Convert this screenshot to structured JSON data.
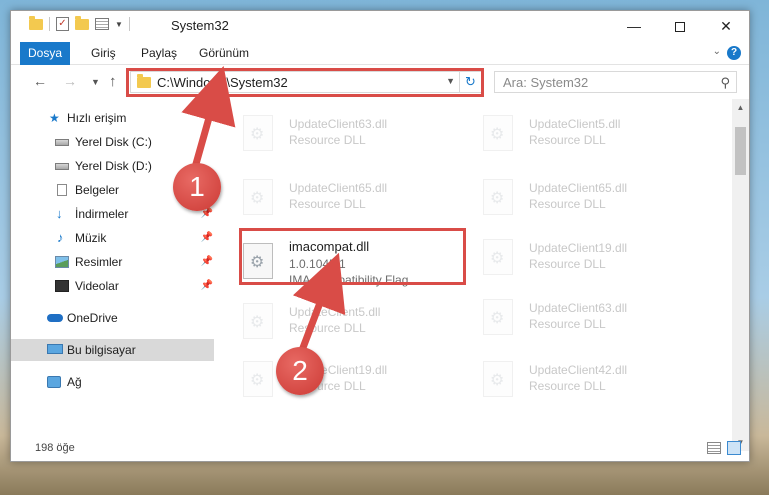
{
  "window": {
    "title": "System32",
    "minimize_glyph": "—",
    "close_glyph": "✕"
  },
  "ribbon": {
    "tabs": [
      "Dosya",
      "Giriş",
      "Paylaş",
      "Görünüm"
    ],
    "help_glyph": "?",
    "expand_glyph": "⌄"
  },
  "address": {
    "path": "C:\\Windows\\System32",
    "search_placeholder": "Ara: System32"
  },
  "nav": {
    "back_glyph": "←",
    "forward_glyph": "→",
    "up_glyph": "↑",
    "items": [
      {
        "label": "Hızlı erişim",
        "icon": "star-icon"
      },
      {
        "label": "Yerel Disk (C:)",
        "icon": "drive-icon",
        "pinned": true
      },
      {
        "label": "Yerel Disk (D:)",
        "icon": "drive-icon",
        "pinned": true
      },
      {
        "label": "Belgeler",
        "icon": "documents-icon",
        "pinned": true
      },
      {
        "label": "İndirmeler",
        "icon": "downloads-icon",
        "pinned": true
      },
      {
        "label": "Müzik",
        "icon": "music-icon",
        "pinned": true
      },
      {
        "label": "Resimler",
        "icon": "pictures-icon",
        "pinned": true
      },
      {
        "label": "Videolar",
        "icon": "videos-icon",
        "pinned": true
      },
      {
        "label": "OneDrive",
        "icon": "onedrive-icon"
      },
      {
        "label": "Bu bilgisayar",
        "icon": "pc-icon",
        "selected": true
      },
      {
        "label": "Ağ",
        "icon": "network-icon"
      }
    ]
  },
  "files": {
    "left": [
      {
        "name": "UpdateClient63.dll",
        "type": "Resource DLL"
      },
      {
        "name": "UpdateClient65.dll",
        "type": "Resource DLL"
      },
      {
        "name": "imacompat.dll",
        "version": "1.0.1045.1",
        "description": "IMA Compatibility Flag"
      },
      {
        "name": "UpdateClient5.dll",
        "type": "Resource DLL"
      },
      {
        "name": "UpdateClient19.dll",
        "type": "Resource DLL"
      }
    ],
    "right": [
      {
        "name": "UpdateClient5.dll",
        "type": "Resource DLL"
      },
      {
        "name": "UpdateClient65.dll",
        "type": "Resource DLL"
      },
      {
        "name": "UpdateClient19.dll",
        "type": "Resource DLL"
      },
      {
        "name": "UpdateClient63.dll",
        "type": "Resource DLL"
      },
      {
        "name": "UpdateClient42.dll",
        "type": "Resource DLL"
      }
    ]
  },
  "status": {
    "item_count": "198 öğe"
  },
  "annotations": {
    "callout_1": "1",
    "callout_2": "2",
    "highlight_color": "#d94c47"
  }
}
